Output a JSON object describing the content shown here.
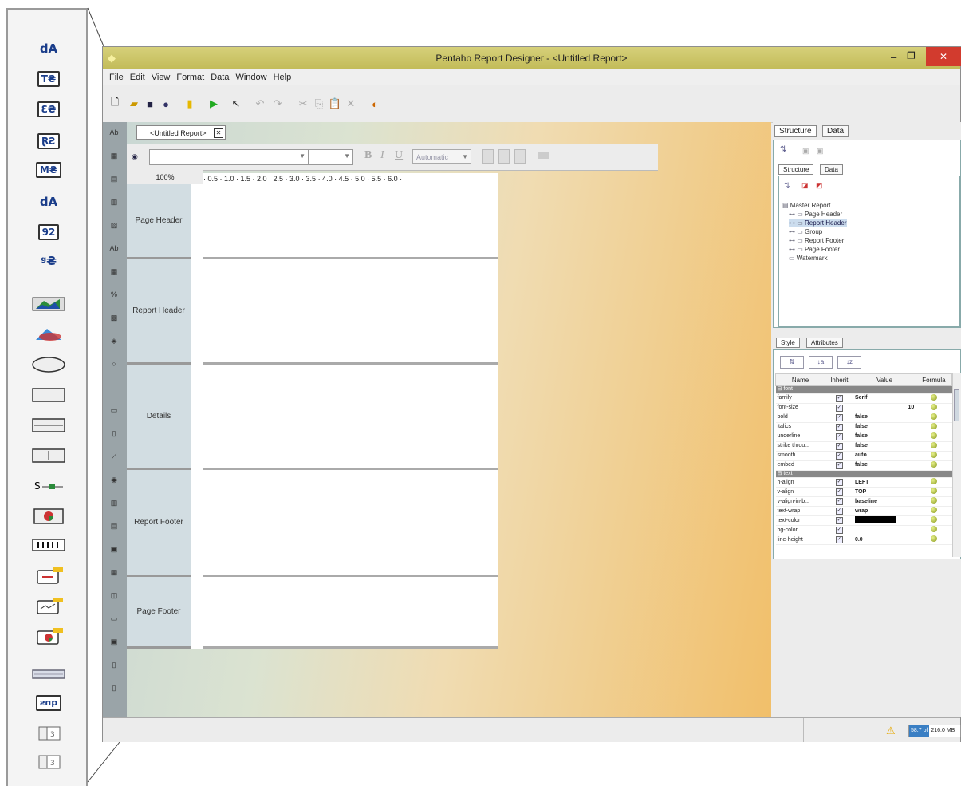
{
  "palette": {
    "items": [
      {
        "label": "dA",
        "kind": "text"
      },
      {
        "label": "T₴",
        "kind": "box"
      },
      {
        "label": "Ɛ₴",
        "kind": "box"
      },
      {
        "label": "ⱤƧ",
        "kind": "box"
      },
      {
        "label": "M₴",
        "kind": "box"
      },
      {
        "label": "dA",
        "kind": "text"
      },
      {
        "label": "92",
        "kind": "box"
      },
      {
        "label": "ᵍ₴",
        "kind": "text"
      },
      {
        "label": "",
        "kind": "chart"
      },
      {
        "label": "",
        "kind": "shape"
      },
      {
        "label": "",
        "kind": "ellipse"
      },
      {
        "label": "",
        "kind": "rect"
      },
      {
        "label": "",
        "kind": "hline"
      },
      {
        "label": "",
        "kind": "vline"
      },
      {
        "label": "",
        "kind": "survey"
      },
      {
        "label": "",
        "kind": "pie"
      },
      {
        "label": "",
        "kind": "barcode"
      },
      {
        "label": "",
        "kind": "bar-sparkline"
      },
      {
        "label": "",
        "kind": "line-sparkline"
      },
      {
        "label": "",
        "kind": "pie-sparkline"
      },
      {
        "label": "",
        "kind": "band"
      },
      {
        "label": "sub",
        "kind": "sub"
      },
      {
        "label": "",
        "kind": "table"
      },
      {
        "label": "",
        "kind": "table"
      }
    ]
  },
  "window": {
    "title": "Pentaho Report Designer - <Untitled Report>",
    "menu": [
      "File",
      "Edit",
      "View",
      "Format",
      "Data",
      "Window",
      "Help"
    ]
  },
  "editor": {
    "tab_label": "<Untitled Report>",
    "zoom": "100%",
    "ruler": "· 0.5 · 1.0 · 1.5 · 2.0 · 2.5 · 3.0 · 3.5 · 4.0 · 4.5 · 5.0 · 5.5 · 6.0 ·",
    "font_color": "Automatic",
    "bands": [
      "Page Header",
      "Report Header",
      "Details",
      "Report Footer",
      "Page Footer"
    ]
  },
  "structure": {
    "outer_tabs": [
      "Structure",
      "Data"
    ],
    "inner_tabs": [
      "Structure",
      "Data"
    ],
    "tree": [
      "Master Report",
      "Page Header",
      "Report Header",
      "Group",
      "Report Footer",
      "Page Footer",
      "Watermark"
    ]
  },
  "properties": {
    "tabs": [
      "Style",
      "Attributes"
    ],
    "columns": [
      "Name",
      "Inherit",
      "Value",
      "Formula"
    ],
    "groups": [
      {
        "name": "font",
        "rows": [
          {
            "name": "family",
            "value": "Serif"
          },
          {
            "name": "font-size",
            "value": "10"
          },
          {
            "name": "bold",
            "value": "false"
          },
          {
            "name": "italics",
            "value": "false"
          },
          {
            "name": "underline",
            "value": "false"
          },
          {
            "name": "strike throu...",
            "value": "false"
          },
          {
            "name": "smooth",
            "value": "auto"
          },
          {
            "name": "embed",
            "value": "false"
          }
        ]
      },
      {
        "name": "text",
        "rows": [
          {
            "name": "h-align",
            "value": "LEFT"
          },
          {
            "name": "v-align",
            "value": "TOP"
          },
          {
            "name": "v-align-in-b...",
            "value": "baseline"
          },
          {
            "name": "text-wrap",
            "value": "wrap"
          },
          {
            "name": "text-color",
            "value": ""
          },
          {
            "name": "bg-color",
            "value": ""
          },
          {
            "name": "line-height",
            "value": "0.0"
          }
        ]
      }
    ]
  },
  "status": {
    "memory_used": "58.7 of",
    "memory_total": "216.0 MB"
  },
  "colors": {
    "title": "#c8c160",
    "canvas_start": "#c9d7d3",
    "canvas_end": "#f1bf6a",
    "close": "#d23b2e"
  }
}
